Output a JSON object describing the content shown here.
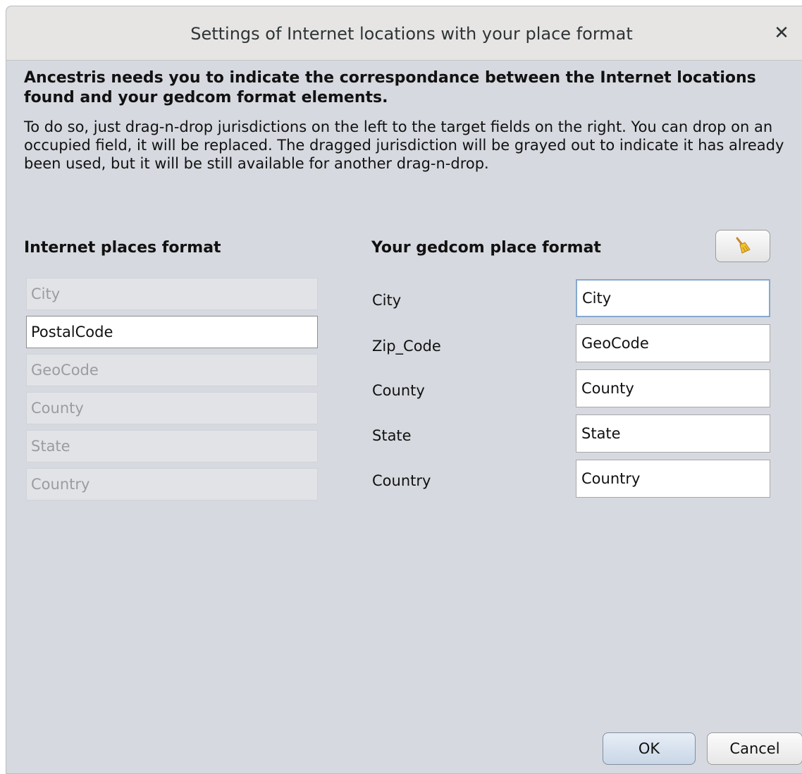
{
  "dialog": {
    "title": "Settings of Internet locations with your place format",
    "close_glyph": "✕"
  },
  "intro": {
    "heading": "Ancestris needs you to indicate the correspondance between the Internet locations found and your gedcom format elements.",
    "body": "To do so, just drag-n-drop jurisdictions on the left to the target fields on the right. You can drop on an occupied field, it will be replaced. The dragged jurisdiction will be grayed out to indicate it has already been used, but it will be still available for another drag-n-drop."
  },
  "internet_places": {
    "title": "Internet places format",
    "items": [
      {
        "label": "City",
        "state": "used"
      },
      {
        "label": "PostalCode",
        "state": "available"
      },
      {
        "label": "GeoCode",
        "state": "used"
      },
      {
        "label": "County",
        "state": "used"
      },
      {
        "label": "State",
        "state": "used"
      },
      {
        "label": "Country",
        "state": "used"
      }
    ]
  },
  "gedcom_places": {
    "title": "Your gedcom place format",
    "clear_button_icon": "broom-icon",
    "rows": [
      {
        "label": "City",
        "value": "City"
      },
      {
        "label": "Zip_Code",
        "value": "GeoCode"
      },
      {
        "label": "County",
        "value": "County"
      },
      {
        "label": "State",
        "value": "State"
      },
      {
        "label": "Country",
        "value": "Country"
      }
    ]
  },
  "buttons": {
    "ok": "OK",
    "cancel": "Cancel"
  }
}
